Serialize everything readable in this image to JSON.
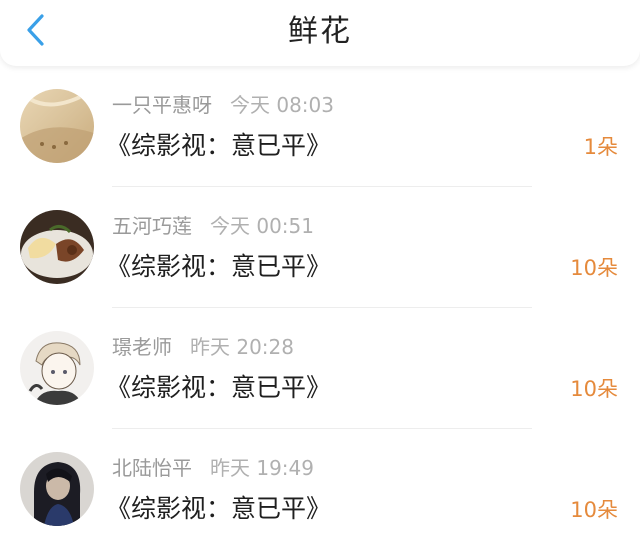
{
  "header": {
    "title": "鲜花",
    "back_icon": "chevron-left-icon",
    "accent_color": "#3aa0e8"
  },
  "list": {
    "items": [
      {
        "user": "一只平惠呀",
        "time": "今天 08:03",
        "book": "《综影视：意已平》",
        "count": "1朵"
      },
      {
        "user": "五河巧莲",
        "time": "今天 00:51",
        "book": "《综影视：意已平》",
        "count": "10朵"
      },
      {
        "user": "璟老师",
        "time": "昨天 20:28",
        "book": "《综影视：意已平》",
        "count": "10朵"
      },
      {
        "user": "北陆怡平",
        "time": "昨天 19:49",
        "book": "《综影视：意已平》",
        "count": "10朵"
      }
    ]
  },
  "colors": {
    "count": "#e58a3c",
    "name": "#9a9a9a",
    "book": "#1f1f1f"
  }
}
